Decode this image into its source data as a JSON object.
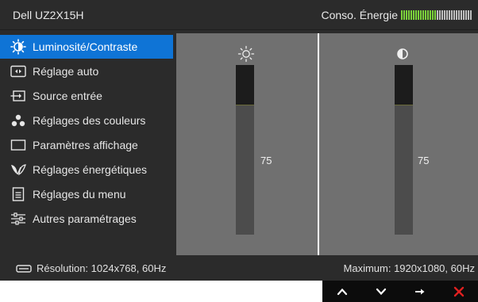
{
  "header": {
    "model": "Dell UZ2X15H",
    "energy_label": "Conso. Énergie",
    "energy_level": 0.5,
    "energy_colors": {
      "on": "#7bd33a",
      "off": "#bfbfbf"
    }
  },
  "menu": {
    "items": [
      {
        "label": "Luminosité/Contraste",
        "icon": "brightness-contrast-icon",
        "active": true
      },
      {
        "label": "Réglage auto",
        "icon": "auto-adjust-icon",
        "active": false
      },
      {
        "label": "Source entrée",
        "icon": "input-source-icon",
        "active": false
      },
      {
        "label": "Réglages des couleurs",
        "icon": "color-settings-icon",
        "active": false
      },
      {
        "label": "Paramètres affichage",
        "icon": "display-settings-icon",
        "active": false
      },
      {
        "label": "Réglages énergétiques",
        "icon": "energy-settings-icon",
        "active": false
      },
      {
        "label": "Réglages du menu",
        "icon": "menu-settings-icon",
        "active": false
      },
      {
        "label": "Autres paramétrages",
        "icon": "other-settings-icon",
        "active": false
      }
    ]
  },
  "sliders": {
    "brightness": {
      "icon": "sun-icon",
      "value": "75",
      "fraction": 0.75
    },
    "contrast": {
      "icon": "contrast-icon",
      "value": "75",
      "fraction": 0.75
    }
  },
  "footer": {
    "resolution": "Résolution: 1024x768, 60Hz",
    "maximum": "Maximum: 1920x1080, 60Hz"
  },
  "nav": {
    "buttons": [
      "up-arrow-icon",
      "down-arrow-icon",
      "right-arrow-icon",
      "close-icon"
    ]
  },
  "colors": {
    "accent": "#0f74d6",
    "exit": "#e02020"
  }
}
